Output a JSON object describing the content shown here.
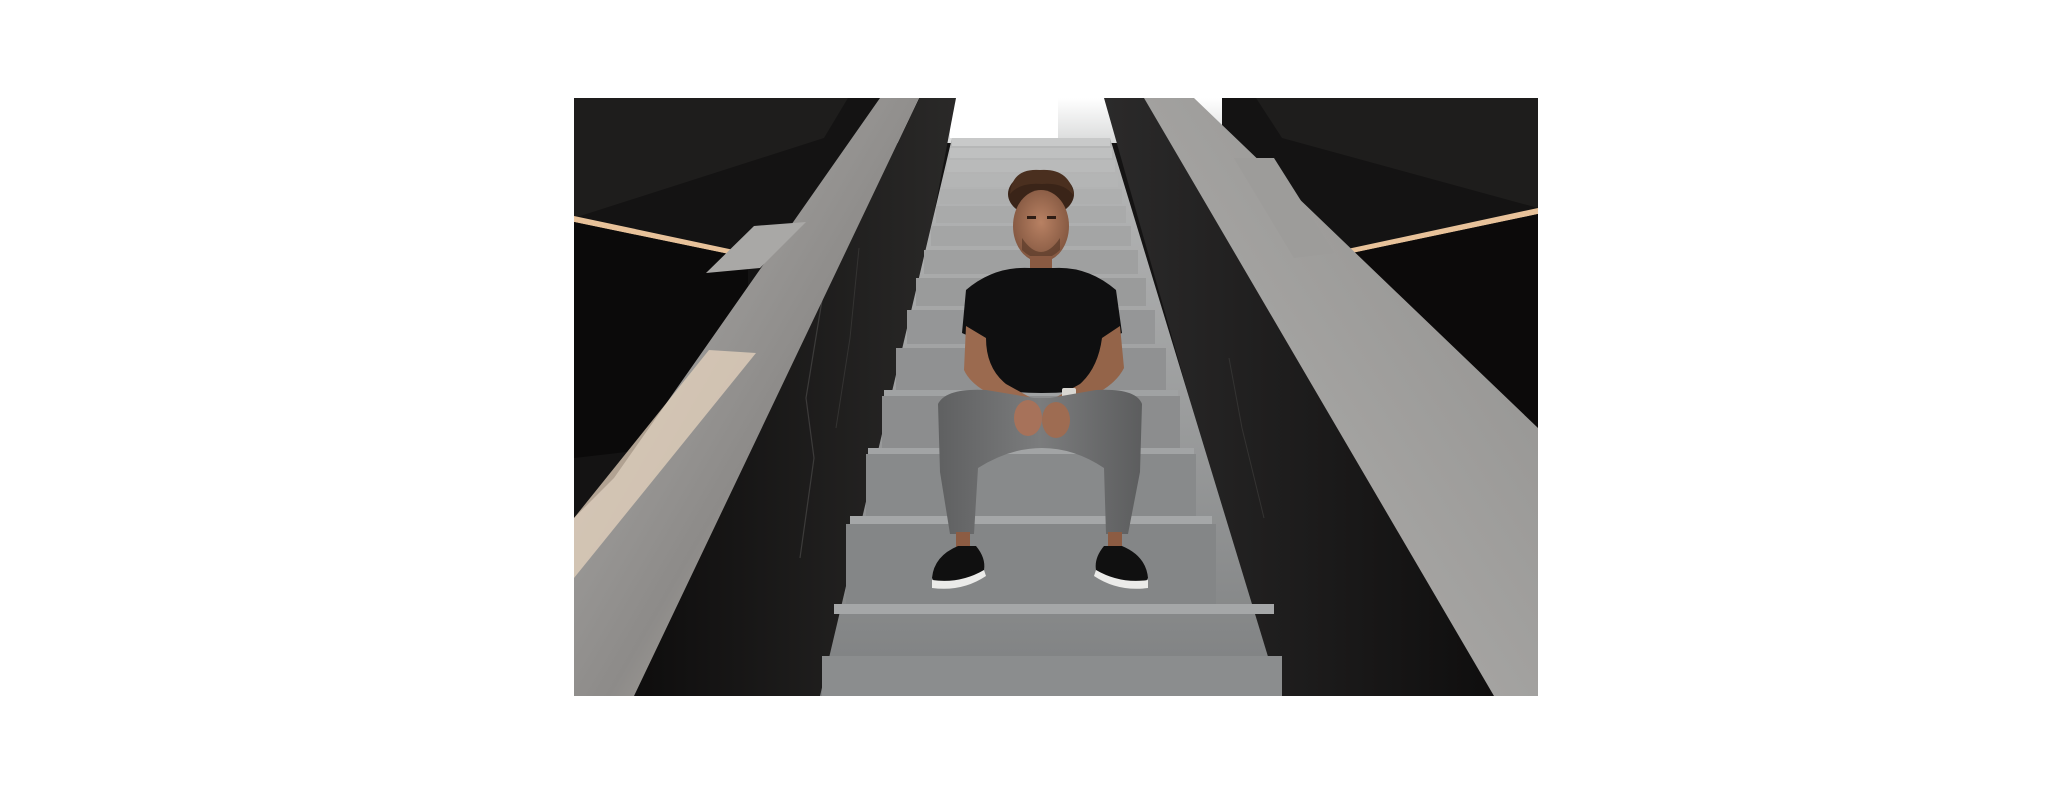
{
  "page": {
    "background": "#ffffff"
  },
  "photo": {
    "subject": "man-seated-on-stairs",
    "colors": {
      "stair": "#8e9091",
      "stair_highlight": "#a9abac",
      "wall_dark": "#1b1a1a",
      "rail": "#9c9c9a",
      "skylight": "#f4f4f2",
      "shirt": "#0f0f10",
      "pants": "#6f7071",
      "skin": "#a06e52",
      "hair": "#3a2418",
      "shoe": "#101010",
      "sole": "#e9e9e7",
      "warm_light": "#e9c9a0"
    }
  }
}
